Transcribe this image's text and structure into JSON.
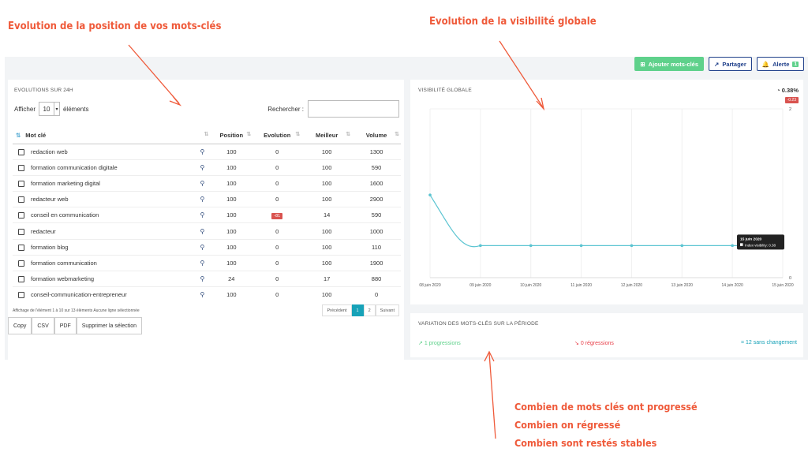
{
  "annotations": {
    "top_left": "Evolution de la position de vos mots-clés",
    "top_right": "Evolution de la visibilité globale",
    "bottom_lines": [
      "Combien de mots clés ont progressé",
      "Combien on régressé",
      "Combien sont restés stables"
    ]
  },
  "toolbar": {
    "add_keywords": "Ajouter mots-clés",
    "share": "Partager",
    "alert": "Alerte",
    "alert_count": "1"
  },
  "evolutions": {
    "title": "EVOLUTIONS SUR 24H",
    "show_label": "Afficher",
    "show_value": "10",
    "elements_label": "éléments",
    "search_label": "Rechercher :",
    "columns": [
      "Mot clé",
      "Position",
      "Evolution",
      "Meilleur",
      "Volume"
    ],
    "rows": [
      {
        "keyword": "redaction web",
        "position": "100",
        "evolution": "0",
        "best": "100",
        "volume": "1300"
      },
      {
        "keyword": "formation communication digitale",
        "position": "100",
        "evolution": "0",
        "best": "100",
        "volume": "590"
      },
      {
        "keyword": "formation marketing digital",
        "position": "100",
        "evolution": "0",
        "best": "100",
        "volume": "1600"
      },
      {
        "keyword": "redacteur web",
        "position": "100",
        "evolution": "0",
        "best": "100",
        "volume": "2900"
      },
      {
        "keyword": "conseil en communication",
        "position": "100",
        "evolution": "-81",
        "best": "14",
        "volume": "590"
      },
      {
        "keyword": "redacteur",
        "position": "100",
        "evolution": "0",
        "best": "100",
        "volume": "1000"
      },
      {
        "keyword": "formation blog",
        "position": "100",
        "evolution": "0",
        "best": "100",
        "volume": "110"
      },
      {
        "keyword": "formation communication",
        "position": "100",
        "evolution": "0",
        "best": "100",
        "volume": "1900"
      },
      {
        "keyword": "formation webmarketing",
        "position": "24",
        "evolution": "0",
        "best": "17",
        "volume": "880"
      },
      {
        "keyword": "conseil-communication-entrepreneur",
        "position": "100",
        "evolution": "0",
        "best": "100",
        "volume": "0"
      }
    ],
    "info": "Affichage de l'élément 1 à 10 sur 13 éléments   Aucune ligne sélectionnée",
    "pager": {
      "prev": "Précédent",
      "p1": "1",
      "p2": "2",
      "next": "Suivant"
    },
    "exports": [
      "Copy",
      "CSV",
      "PDF",
      "Supprimer la sélection"
    ]
  },
  "visibility": {
    "title": "VISIBILITÉ GLOBALE",
    "value": "0.38%",
    "delta": "-0.23",
    "tooltip_date": "15 juin 2020",
    "tooltip_label": "Index visibility: 0.38"
  },
  "variation": {
    "title": "VARIATION DES MOTS-CLÉS SUR LA PÉRIODE",
    "progressions": "1 progressions",
    "regressions": "0 régressions",
    "unchanged": "12 sans changement"
  },
  "chart_data": {
    "type": "line",
    "x": [
      "08 juin 2020",
      "09 juin 2020",
      "10 juin 2020",
      "11 juin 2020",
      "12 juin 2020",
      "13 juin 2020",
      "14 juin 2020",
      "15 juin 2020"
    ],
    "series": [
      {
        "values": [
          0.98,
          0.38,
          0.38,
          0.38,
          0.38,
          0.38,
          0.38,
          0.38
        ]
      }
    ],
    "ylim": [
      0,
      2
    ],
    "y_ticks": [
      "0",
      "2"
    ],
    "grid": true,
    "color": "#5bc4d1"
  }
}
